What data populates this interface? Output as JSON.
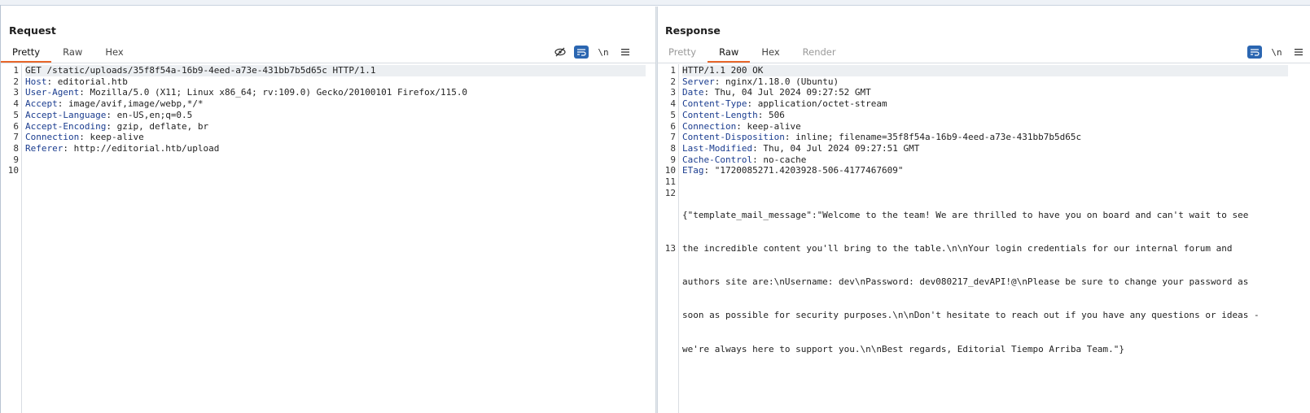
{
  "request": {
    "title": "Request",
    "tabs": [
      {
        "label": "Pretty",
        "active": true
      },
      {
        "label": "Raw",
        "active": false
      },
      {
        "label": "Hex",
        "active": false
      }
    ],
    "tools": {
      "hide_icon": "eye-slash-icon",
      "wrap_icon": "wrap-icon",
      "newline_label": "\\n",
      "menu_icon": "hamburger-menu-icon"
    },
    "line_numbers": [
      "1",
      "2",
      "3",
      "4",
      "5",
      "6",
      "7",
      "8",
      "9",
      "10"
    ],
    "lines": [
      {
        "plain": "GET /static/uploads/35f8f54a-16b9-4eed-a73e-431bb7b5d65c HTTP/1.1"
      },
      {
        "key": "Host",
        "value": ": editorial.htb"
      },
      {
        "key": "User-Agent",
        "value": ": Mozilla/5.0 (X11; Linux x86_64; rv:109.0) Gecko/20100101 Firefox/115.0"
      },
      {
        "key": "Accept",
        "value": ": image/avif,image/webp,*/*"
      },
      {
        "key": "Accept-Language",
        "value": ": en-US,en;q=0.5"
      },
      {
        "key": "Accept-Encoding",
        "value": ": gzip, deflate, br"
      },
      {
        "key": "Connection",
        "value": ": keep-alive"
      },
      {
        "key": "Referer",
        "value": ": http://editorial.htb/upload"
      }
    ]
  },
  "response": {
    "title": "Response",
    "tabs": [
      {
        "label": "Pretty",
        "active": false,
        "disabled": true
      },
      {
        "label": "Raw",
        "active": true
      },
      {
        "label": "Hex",
        "active": false
      },
      {
        "label": "Render",
        "active": false,
        "disabled": true
      }
    ],
    "tools": {
      "wrap_icon": "wrap-icon",
      "newline_label": "\\n",
      "menu_icon": "hamburger-menu-icon"
    },
    "line_numbers": [
      "1",
      "2",
      "3",
      "4",
      "5",
      "6",
      "7",
      "8",
      "9",
      "10",
      "11",
      "12",
      "13"
    ],
    "lines": [
      {
        "plain": "HTTP/1.1 200 OK"
      },
      {
        "key": "Server",
        "value": ": nginx/1.18.0 (Ubuntu)"
      },
      {
        "key": "Date",
        "value": ": Thu, 04 Jul 2024 09:27:52 GMT"
      },
      {
        "key": "Content-Type",
        "value": ": application/octet-stream"
      },
      {
        "key": "Content-Length",
        "value": ": 506"
      },
      {
        "key": "Connection",
        "value": ": keep-alive"
      },
      {
        "key": "Content-Disposition",
        "value": ": inline; filename=35f8f54a-16b9-4eed-a73e-431bb7b5d65c"
      },
      {
        "key": "Last-Modified",
        "value": ": Thu, 04 Jul 2024 09:27:51 GMT"
      },
      {
        "key": "Cache-Control",
        "value": ": no-cache"
      },
      {
        "key": "ETag",
        "value": ": \"1720085271.4203928-506-4177467609\""
      }
    ],
    "body_lines": [
      "{\"template_mail_message\":\"Welcome to the team! We are thrilled to have you on board and can't wait to see",
      "the incredible content you'll bring to the table.\\n\\nYour login credentials for our internal forum and",
      "authors site are:\\nUsername: dev\\nPassword: dev080217_devAPI!@\\nPlease be sure to change your password as",
      "soon as possible for security purposes.\\n\\nDon't hesitate to reach out if you have any questions or ideas -",
      "we're always here to support you.\\n\\nBest regards, Editorial Tiempo Arriba Team.\"}"
    ]
  },
  "layout_switch": {
    "buttons": [
      {
        "name": "side-by-side",
        "active": true
      },
      {
        "name": "top-bottom",
        "active": false
      },
      {
        "name": "single",
        "active": false
      }
    ]
  }
}
